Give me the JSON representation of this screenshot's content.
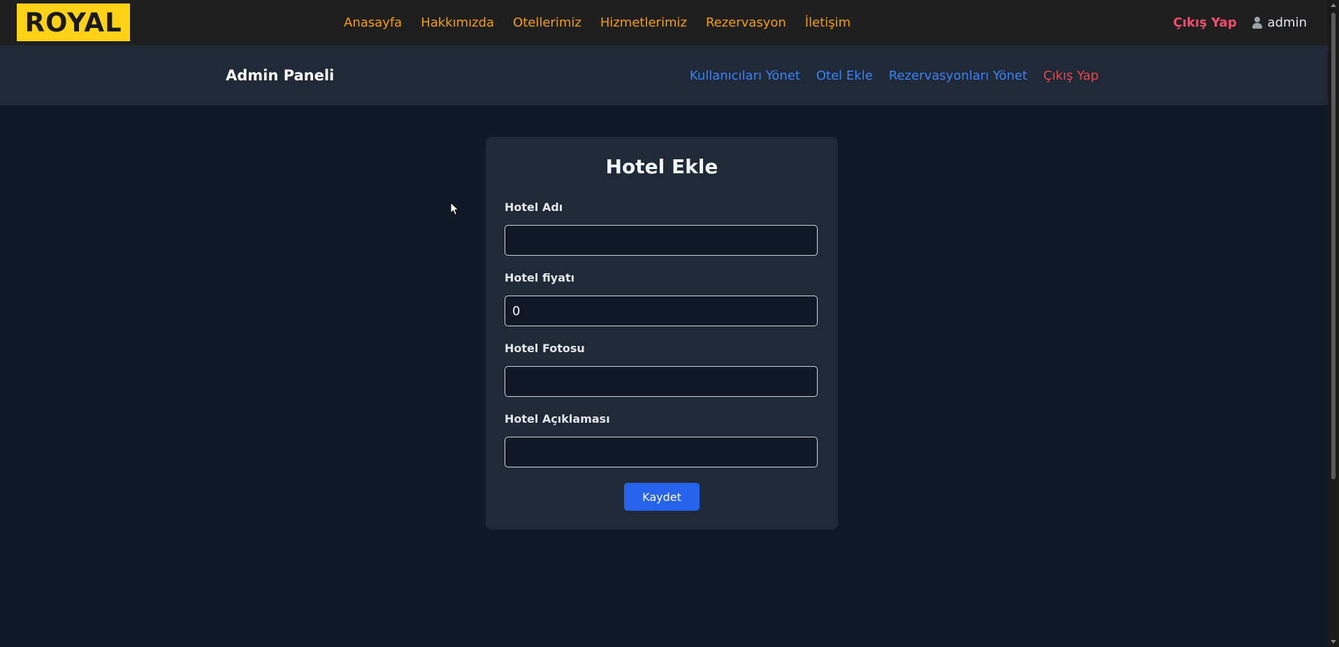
{
  "topbar": {
    "logo": "ROYAL",
    "nav": [
      "Anasayfa",
      "Hakkımızda",
      "Otellerimiz",
      "Hizmetlerimiz",
      "Rezervasyon",
      "İletişim"
    ],
    "logout": "Çıkış Yap",
    "username": "admin"
  },
  "adminbar": {
    "title": "Admin Paneli",
    "links": [
      "Kullanıcıları Yönet",
      "Otel Ekle",
      "Rezervasyonları Yönet",
      "Çıkış Yap"
    ]
  },
  "form": {
    "title": "Hotel Ekle",
    "fields": [
      {
        "label": "Hotel Adı",
        "value": ""
      },
      {
        "label": "Hotel fiyatı",
        "value": "0"
      },
      {
        "label": "Hotel Fotosu",
        "value": ""
      },
      {
        "label": "Hotel Açıklaması",
        "value": ""
      }
    ],
    "submit": "Kaydet"
  },
  "colors": {
    "background": "#111827",
    "card": "#1f2937",
    "logo_bg": "#fcd116",
    "nav_link": "#f59e0b",
    "admin_link": "#3b82f6",
    "logout": "#ef4444",
    "button": "#2563eb"
  },
  "icons": {
    "user": "user-icon",
    "cursor": "mouse-cursor-icon"
  }
}
